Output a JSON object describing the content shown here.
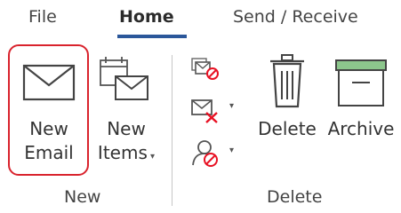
{
  "tabs": [
    {
      "label": "File",
      "active": false
    },
    {
      "label": "Home",
      "active": true
    },
    {
      "label": "Send / Receive",
      "active": false
    }
  ],
  "ribbon": {
    "new_group": {
      "label": "New",
      "new_email": {
        "line1": "New",
        "line2": "Email",
        "icon": "envelope-icon"
      },
      "new_items": {
        "line1": "New",
        "line2": "Items",
        "icon": "new-items-icon"
      }
    },
    "delete_group": {
      "label": "Delete",
      "ignore": {
        "icon": "ignore-icon"
      },
      "clean_up": {
        "icon": "clean-up-icon"
      },
      "junk": {
        "icon": "junk-icon"
      },
      "delete": {
        "label": "Delete",
        "icon": "trash-can-icon"
      },
      "archive": {
        "label": "Archive",
        "icon": "archive-box-icon"
      }
    }
  },
  "colors": {
    "active_tab_underline": "#2b579a",
    "highlight_border": "#d9232d",
    "icon_red": "#e81123",
    "archive_green": "#8cc68c"
  }
}
